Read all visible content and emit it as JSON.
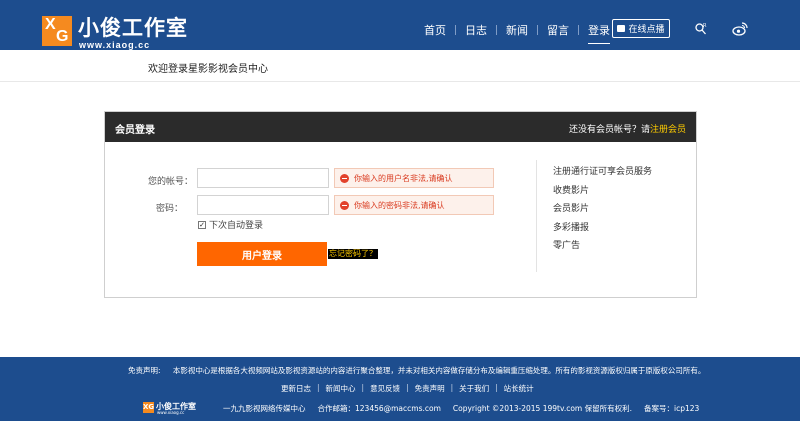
{
  "header": {
    "logo_mark": "XG",
    "logo_title": "小俊工作室",
    "logo_url": "www.xiaog.cc",
    "nav": [
      "首页",
      "日志",
      "新闻",
      "留言",
      "登录"
    ],
    "live_label": "在线点播",
    "search_icon": "search-icon",
    "weibo_icon": "weibo-icon"
  },
  "welcome": "欢迎登录星影影视会员中心",
  "panel": {
    "title": "会员登录",
    "no_account_text": "还没有会员帐号？请",
    "register_link": "注册会员",
    "account_label": "您的帐号：",
    "account_value": "",
    "account_error": "你输入的用户名非法,请确认",
    "password_label": "密码：",
    "password_value": "",
    "password_error": "你输入的密码非法,请确认",
    "remember_label": "下次自动登录",
    "remember_checked": true,
    "login_button": "用户登录",
    "forgot_link": "忘记密码了？",
    "side_items": [
      "注册通行证可享会员服务",
      "收费影片",
      "会员影片",
      "多彩播报",
      "零广告"
    ]
  },
  "footer": {
    "disclaimer_label": "免责声明:",
    "disclaimer_text": "本影视中心是根据各大视频网站及影视资源站的内容进行聚合整理，并未对相关内容做存储分布及编辑重压缩处理。所有的影视资源版权归属于原版权公司所有。",
    "links": [
      "更新日志",
      "新闻中心",
      "意见反馈",
      "免责声明",
      "关于我们",
      "站长统计"
    ],
    "logo_title": "小俊工作室",
    "logo_url": "www.xiaog.cc",
    "company": "一九九影视网络传媒中心",
    "email_label": "合作邮箱：123456@maccms.com",
    "copyright": "Copyright ©2013-2015 199tv.com 保留所有权利.",
    "icp": "备案号：icp123"
  },
  "colors": {
    "header_bg": "#1d4d8e",
    "accent_orange": "#ff6600",
    "panel_head_bg": "#2b2b2b",
    "error_text": "#d93a1f",
    "link_yellow": "#ffcc00"
  }
}
